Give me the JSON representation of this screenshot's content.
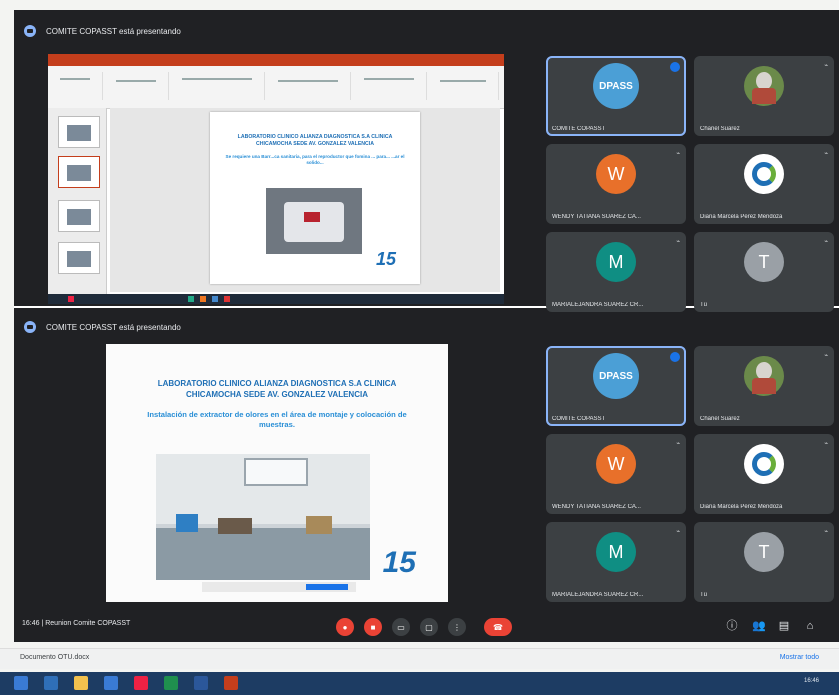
{
  "top_banner": {
    "text": "COMITE COPASST está presentando"
  },
  "second_banner": {
    "text": "COMITE COPASST está presentando"
  },
  "slide_small": {
    "title": "LABORATORIO CLINICO ALIANZA DIAGNOSTICA S.A CLINICA CHICAMOCHA SEDE AV. GONZALEZ VALENCIA",
    "text": "Se requiere una Barr...ca sanitaria, para el reproductor que fomina ... para... ...ar el solido..."
  },
  "slide_large": {
    "title": "LABORATORIO CLINICO ALIANZA DIAGNOSTICA S.A CLINICA CHICAMOCHA SEDE AV. GONZALEZ VALENCIA",
    "subtitle": "Instalación de extractor de olores en el área de montaje y colocación de muestras.",
    "logo": "15"
  },
  "participants_top": [
    {
      "name": "COMITE COPASST",
      "avatar": "DPASS",
      "kind": "dpass"
    },
    {
      "name": "Chanel Suarez",
      "avatar": "",
      "kind": "photo"
    },
    {
      "name": "WENDY TATIANA SUAREZ CA...",
      "avatar": "W",
      "kind": "w"
    },
    {
      "name": "Diana Marcela Perez Mendoza",
      "avatar": "",
      "kind": "logo"
    },
    {
      "name": "MARIALEJANDRA SUAREZ CR...",
      "avatar": "M",
      "kind": "m"
    },
    {
      "name": "Tú",
      "avatar": "T",
      "kind": "t"
    }
  ],
  "participants_bottom": [
    {
      "name": "COMITE COPASST",
      "avatar": "DPASS",
      "kind": "dpass"
    },
    {
      "name": "Chanel Suarez",
      "avatar": "",
      "kind": "photo"
    },
    {
      "name": "WENDY TATIANA SUAREZ CA...",
      "avatar": "W",
      "kind": "w"
    },
    {
      "name": "Diana Marcela Perez Mendoza",
      "avatar": "",
      "kind": "logo"
    },
    {
      "name": "MARIALEJANDRA SUAREZ CR...",
      "avatar": "M",
      "kind": "m"
    },
    {
      "name": "Tú",
      "avatar": "T",
      "kind": "t"
    }
  ],
  "controls": {
    "meeting_label": "16:46 | Reunion Comite COPASST",
    "mic_icon": "mic-off-icon",
    "cam_icon": "camera-off-icon",
    "end_call_icon": "end-call-icon"
  },
  "downloads": {
    "file": "Documento OTU.docx",
    "show_all": "Mostrar todo"
  },
  "tray": {
    "time": "16:46"
  }
}
